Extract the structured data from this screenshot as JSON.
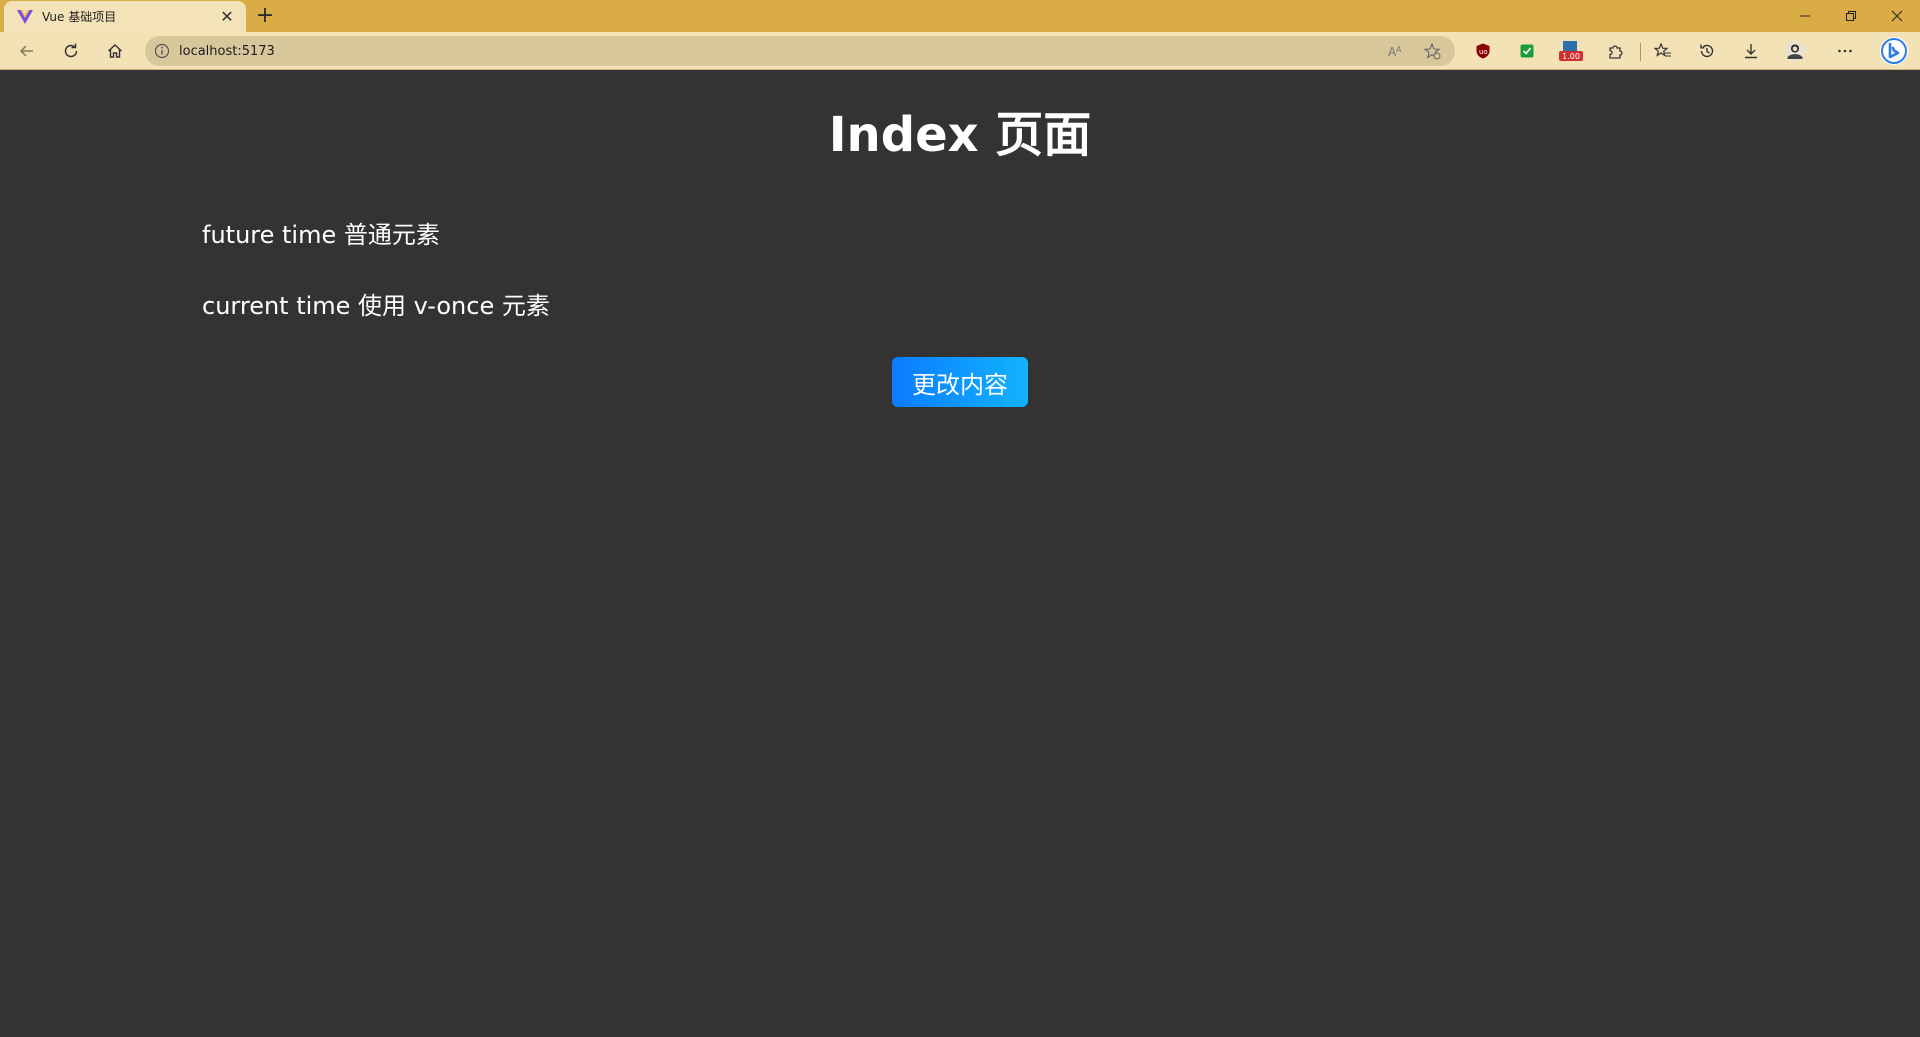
{
  "browser": {
    "tab": {
      "title": "Vue 基础项目",
      "favicon": "vue-logo-icon"
    },
    "address": {
      "url": "localhost:5173"
    },
    "extension_badge": "1.00",
    "colors": {
      "frame": "#d9ac45",
      "toolbar": "#f2e2b6",
      "page_bg": "#333333"
    }
  },
  "page": {
    "title": "Index 页面",
    "line1": "future time 普通元素",
    "line2": "current time 使用 v-once 元素",
    "button_label": "更改内容",
    "button_color": "#0a7cff"
  }
}
